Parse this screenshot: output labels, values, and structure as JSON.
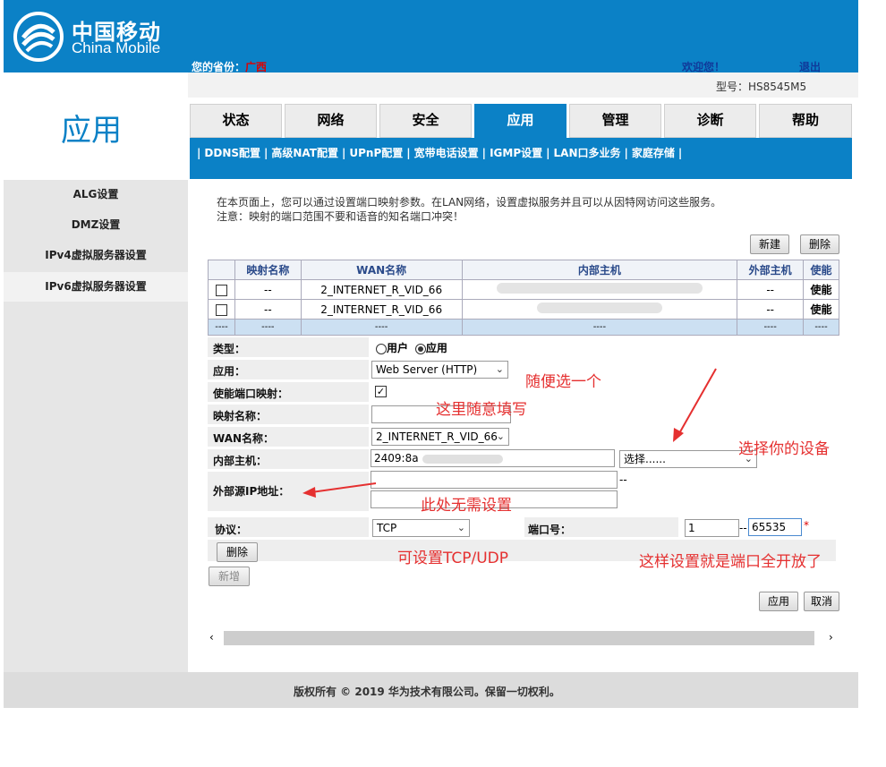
{
  "header": {
    "logo_cn": "中国移动",
    "logo_en": "China Mobile",
    "province_label": "您的省份：",
    "province_value": "广西",
    "welcome": "欢迎您！",
    "logout": "退出",
    "model": "型号：HS8545M5"
  },
  "page_title": "应用",
  "tabs": [
    {
      "label": "状态"
    },
    {
      "label": "网络"
    },
    {
      "label": "安全"
    },
    {
      "label": "应用"
    },
    {
      "label": "管理"
    },
    {
      "label": "诊断"
    },
    {
      "label": "帮助"
    }
  ],
  "subnav": [
    "DDNS配置",
    "高级NAT配置",
    "UPnP配置",
    "宽带电话设置",
    "IGMP设置",
    "LAN口多业务",
    "家庭存储"
  ],
  "sidebar": [
    "ALG设置",
    "DMZ设置",
    "IPv4虚拟服务器设置",
    "IPv6虚拟服务器设置"
  ],
  "description": {
    "line1": "在本页面上，您可以通过设置端口映射参数。在LAN网络，设置虚拟服务并且可以从因特网访问这些服务。",
    "line2": "注意：映射的端口范围不要和语音的知名端口冲突！"
  },
  "buttons": {
    "new": "新建",
    "delete": "删除",
    "row_delete": "删除",
    "row_add": "新增",
    "apply": "应用",
    "cancel": "取消"
  },
  "table": {
    "headers": [
      "",
      "映射名称",
      "WAN名称",
      "内部主机",
      "外部主机",
      "使能"
    ],
    "rows": [
      [
        "",
        "--",
        "2_INTERNET_R_VID_66",
        "",
        "--",
        "使能"
      ],
      [
        "",
        "--",
        "2_INTERNET_R_VID_66",
        "",
        "--",
        "使能"
      ]
    ],
    "blank_row": [
      "----",
      "----",
      "----",
      "----",
      "----",
      "----"
    ]
  },
  "form": {
    "type_label": "类型：",
    "type_option_user": "用户",
    "type_option_app": "应用",
    "app_label": "应用：",
    "app_value": "Web Server (HTTP)",
    "enable_label": "使能端口映射：",
    "name_label": "映射名称：",
    "name_value": "",
    "wan_label": "WAN名称：",
    "wan_value": "2_INTERNET_R_VID_66",
    "host_label": "内部主机：",
    "host_value": "2409:8a",
    "host_select": "选择......",
    "src_ip_label": "外部源IP地址：",
    "src_ip_dash": "--",
    "protocol_label": "协议：",
    "protocol_value": "TCP",
    "port_label": "端口号：",
    "port_start": "1",
    "port_dash": "--",
    "port_end": "65535",
    "required_mark": "*"
  },
  "annotations": {
    "choose_any": "随便选一个",
    "fill_any": "这里随意填写",
    "choose_device": "选择你的设备",
    "no_need": "此处无需设置",
    "tcp_udp": "可设置TCP/UDP",
    "all_open": "这样设置就是端口全开放了"
  },
  "footer": "版权所有 © 2019 华为技术有限公司。保留一切权利。",
  "colors": {
    "brand_blue": "#0b81c6",
    "annotation_red": "#e53030"
  }
}
